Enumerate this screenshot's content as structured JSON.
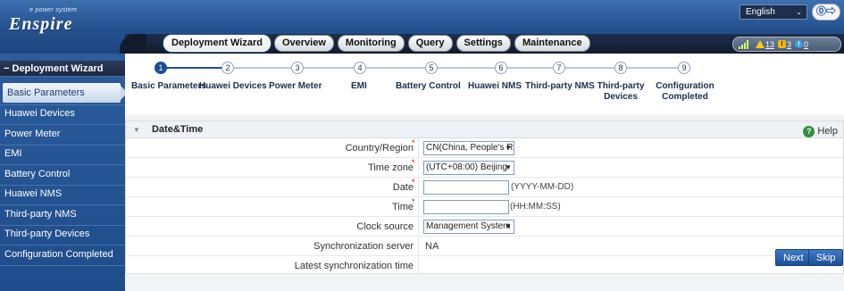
{
  "header": {
    "logo_sub": "e power system",
    "logo_main": "Enspire",
    "language": "English",
    "user_icon_text": "⓪⇨"
  },
  "nav": {
    "tabs": [
      "Deployment Wizard",
      "Overview",
      "Monitoring",
      "Query",
      "Settings",
      "Maintenance"
    ],
    "active_tab": "Deployment Wizard"
  },
  "alarms": {
    "major": "13",
    "minor": "3",
    "warning": "0"
  },
  "sidebar": {
    "title": "Deployment Wizard",
    "items": [
      "Basic Parameters",
      "Huawei Devices",
      "Power Meter",
      "EMI",
      "Battery Control",
      "Huawei NMS",
      "Third-party NMS",
      "Third-party Devices",
      "Configuration Completed"
    ],
    "active_item": "Basic Parameters"
  },
  "wizard": {
    "steps": [
      {
        "num": "1",
        "label": "Basic Parameters"
      },
      {
        "num": "2",
        "label": "Huawei Devices"
      },
      {
        "num": "3",
        "label": "Power Meter"
      },
      {
        "num": "4",
        "label": "EMI"
      },
      {
        "num": "5",
        "label": "Battery Control"
      },
      {
        "num": "6",
        "label": "Huawei NMS"
      },
      {
        "num": "7",
        "label": "Third-party NMS"
      },
      {
        "num": "8",
        "label": "Third-party Devices"
      },
      {
        "num": "9",
        "label": "Configuration Completed"
      }
    ],
    "current_step": 1
  },
  "panel": {
    "title": "Date&Time",
    "help": "Help",
    "fields": {
      "country_label": "Country/Region",
      "country_value": "CN(China, People's Rep",
      "timezone_label": "Time zone",
      "timezone_value": "(UTC+08:00) Beijing",
      "date_label": "Date",
      "date_value": "",
      "date_hint": "(YYYY-MM-DD)",
      "time_label": "Time",
      "time_value": "",
      "time_hint": "(HH:MM:SS)",
      "clock_label": "Clock source",
      "clock_value": "Management System",
      "sync_label": "Synchronization server",
      "sync_value": "NA",
      "latest_label": "Latest synchronization time",
      "latest_value": ""
    }
  },
  "buttons": {
    "next": "Next",
    "skip": "Skip"
  },
  "colors": {
    "nav_blue": "#24508e",
    "step_active": "#1c4f93",
    "required": "#dd0000",
    "help_green": "#2f8f3d"
  }
}
